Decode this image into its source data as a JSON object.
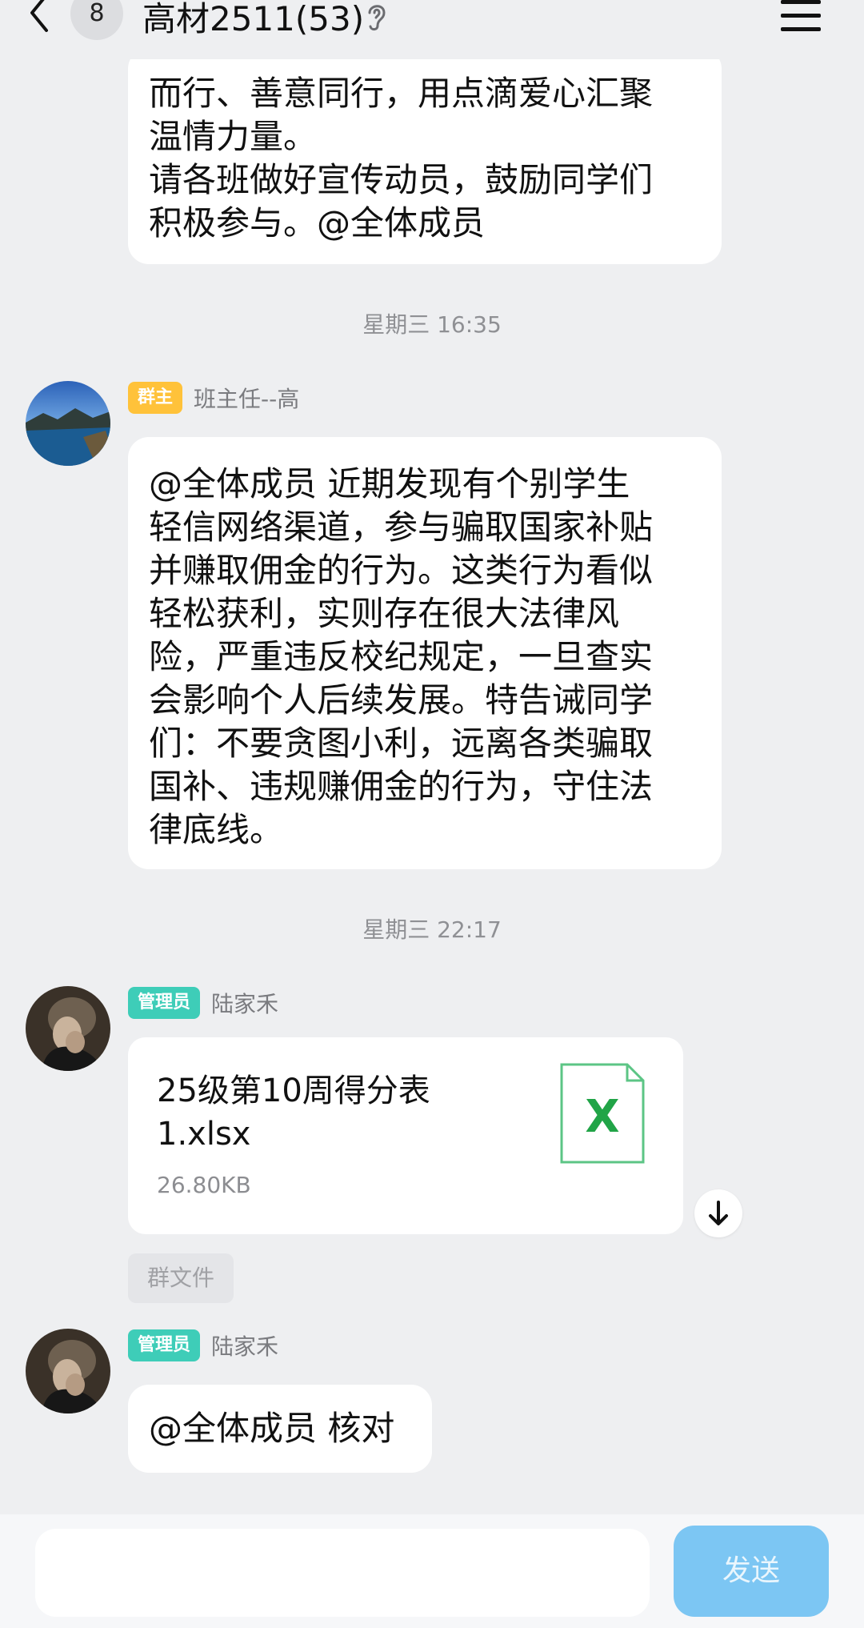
{
  "header": {
    "unread_count": "8",
    "title": "高材2511(53)"
  },
  "messages": {
    "top_bubble_lines": [
      "而行、善意同行，用点滴爱心汇聚",
      "温情力量。",
      "请各班做好宣传动员，鼓励同学们",
      "积极参与。@全体成员"
    ],
    "time1": "星期三 16:35",
    "owner_badge": "群主",
    "owner_name": "班主任--高",
    "notice_lines": [
      "@全体成员 近期发现有个别学生",
      "轻信网络渠道，参与骗取国家补贴",
      "并赚取佣金的行为。这类行为看似",
      "轻松获利，实则存在很大法律风",
      "险，严重违反校纪规定，一旦查实",
      "会影响个人后续发展。特告诫同学",
      "们：不要贪图小利，远离各类骗取",
      "国补、违规赚佣金的行为，守住法",
      "律底线。"
    ],
    "time2": "星期三 22:17",
    "admin_badge": "管理员",
    "admin_name": "陆家禾",
    "file": {
      "name_line1": "25级第10周得分表",
      "name_line2": "1.xlsx",
      "size": "26.80KB",
      "icon_letter": "X"
    },
    "file_tag": "群文件",
    "admin_badge2": "管理员",
    "admin_name2": "陆家禾",
    "verify_text": "@全体成员 核对"
  },
  "input": {
    "value": "",
    "send_label": "发送"
  },
  "colors": {
    "background": "#eeeff1",
    "owner_badge": "#ffc23a",
    "admin_badge": "#3ecdb8",
    "send_button": "#7cc6f3",
    "excel_green": "#21a447"
  },
  "icons": {
    "back": "chevron-left-icon",
    "listen": "ear-icon",
    "menu": "hamburger-menu-icon",
    "file": "excel-file-icon",
    "download": "download-arrow-icon"
  }
}
